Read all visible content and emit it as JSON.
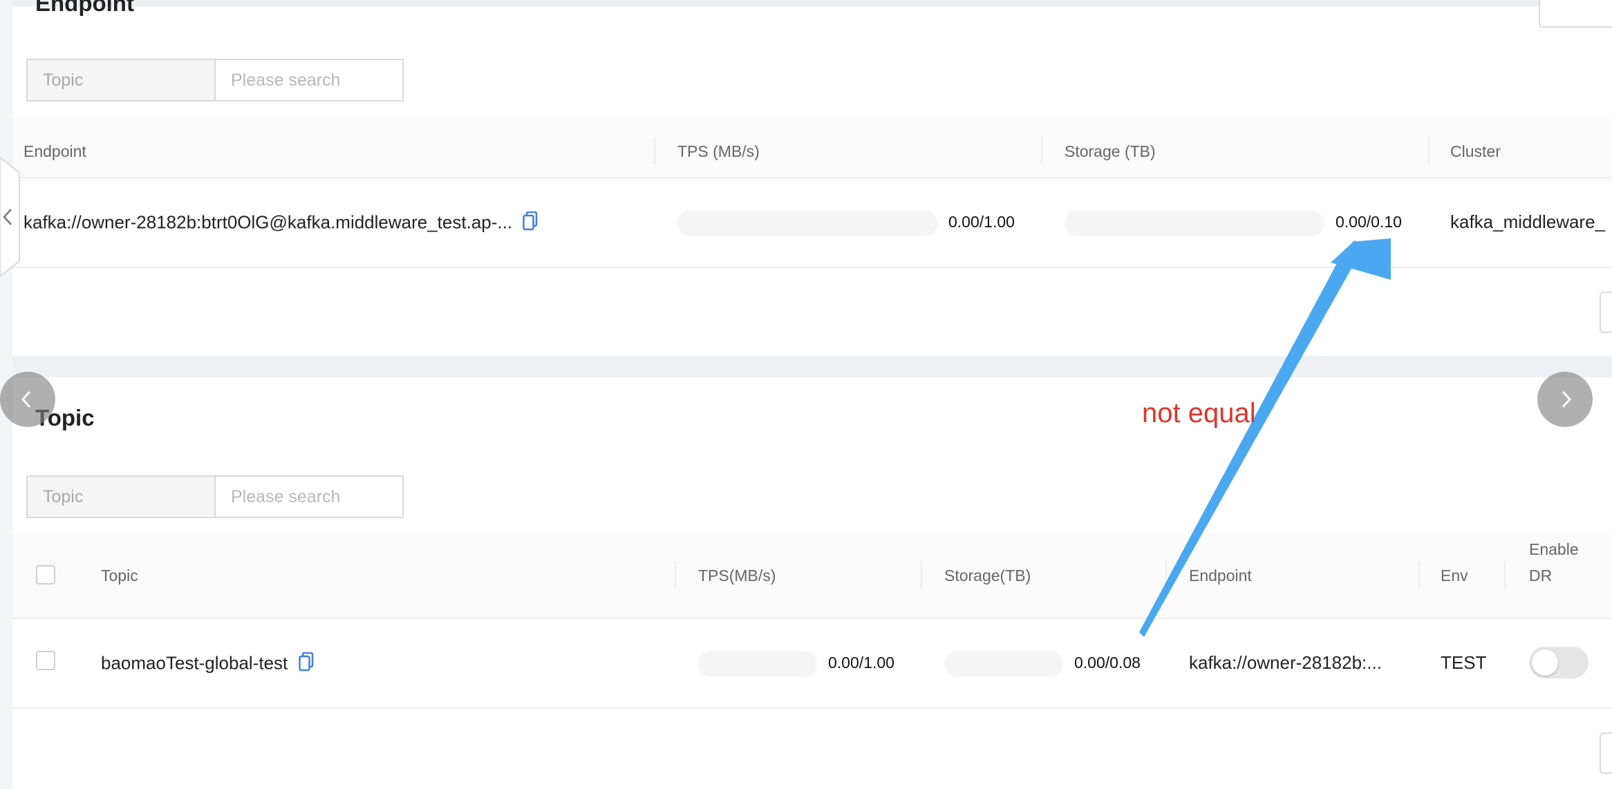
{
  "endpoint_section": {
    "title": "Endpoint",
    "search": {
      "field": "Topic",
      "placeholder": "Please search"
    },
    "columns": {
      "endpoint": "Endpoint",
      "tps": "TPS (MB/s)",
      "storage": "Storage (TB)",
      "cluster": "Cluster"
    },
    "rows": [
      {
        "endpoint": "kafka://owner-28182b:btrt0OlG@kafka.middleware_test.ap-...",
        "tps": "0.00/1.00",
        "tps_fraction": 0.0,
        "storage": "0.00/0.10",
        "storage_fraction": 0.0,
        "cluster": "kafka_middleware_"
      }
    ]
  },
  "topic_section": {
    "title": "Topic",
    "search": {
      "field": "Topic",
      "placeholder": "Please search"
    },
    "columns": {
      "topic": "Topic",
      "tps": "TPS(MB/s)",
      "storage": "Storage(TB)",
      "endpoint": "Endpoint",
      "env": "Env",
      "enable_dr_line1": "Enable",
      "enable_dr_line2": "DR"
    },
    "rows": [
      {
        "topic": "baomaoTest-global-test",
        "tps": "0.00/1.00",
        "tps_fraction": 0.0,
        "storage": "0.00/0.08",
        "storage_fraction": 0.0,
        "endpoint": "kafka://owner-28182b:...",
        "env": "TEST",
        "enable_dr": false
      }
    ]
  },
  "annotation": {
    "text": "not equal",
    "color": "#e0342a",
    "arrow_color": "#4aa8f0"
  },
  "colors": {
    "accent": "#1677ff",
    "copy_icon": "#3f7be8"
  },
  "icons": {
    "collapse": "chevron-left-icon",
    "prev": "chevron-left-icon",
    "next": "chevron-right-icon",
    "copy": "copy-icon"
  }
}
